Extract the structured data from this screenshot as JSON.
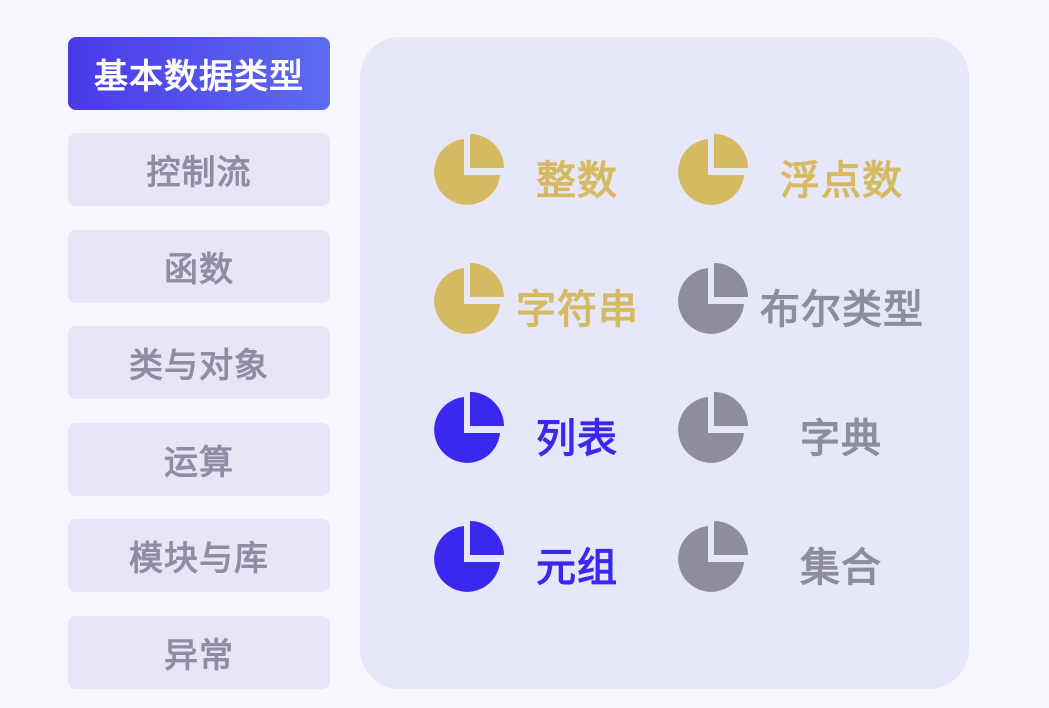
{
  "colors": {
    "gold": "#d6ba62",
    "blue": "#3b28ee",
    "gray": "#8e8ca1",
    "panel": "#e6e7f8",
    "nav_bg": "#e6e6f7",
    "active_start": "#4a39e8",
    "active_end": "#5d6cf0"
  },
  "sidebar": {
    "items": [
      {
        "label": "基本数据类型",
        "active": true
      },
      {
        "label": "控制流",
        "active": false
      },
      {
        "label": "函数",
        "active": false
      },
      {
        "label": "类与对象",
        "active": false
      },
      {
        "label": "运算",
        "active": false
      },
      {
        "label": "模块与库",
        "active": false
      },
      {
        "label": "异常",
        "active": false
      }
    ]
  },
  "types": [
    {
      "label": "整数",
      "color": "#d6ba62",
      "icon": "pie-chart-icon"
    },
    {
      "label": "浮点数",
      "color": "#d6ba62",
      "icon": "pie-chart-icon"
    },
    {
      "label": "字符串",
      "color": "#d6ba62",
      "icon": "pie-chart-icon"
    },
    {
      "label": "布尔类型",
      "color": "#8e8ca1",
      "icon": "pie-chart-icon"
    },
    {
      "label": "列表",
      "color": "#3b28ee",
      "icon": "pie-chart-icon"
    },
    {
      "label": "字典",
      "color": "#8e8ca1",
      "icon": "pie-chart-icon"
    },
    {
      "label": "元组",
      "color": "#3b28ee",
      "icon": "pie-chart-icon"
    },
    {
      "label": "集合",
      "color": "#8e8ca1",
      "icon": "pie-chart-icon"
    }
  ]
}
